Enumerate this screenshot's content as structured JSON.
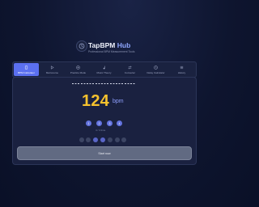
{
  "app": {
    "title_part1": "TapBPM",
    "title_part2": " Hub",
    "tagline": "Professional BPM Measurement Tools",
    "accent_color": "#5b70f0",
    "bpm_color": "#f6c22e"
  },
  "tabs": [
    {
      "label": "BPM Calculator",
      "icon": "tap-icon",
      "active": true
    },
    {
      "label": "Metronome",
      "icon": "play-icon",
      "active": false
    },
    {
      "label": "Practice Mode",
      "icon": "target-icon",
      "active": false
    },
    {
      "label": "Music Theory",
      "icon": "music-note-icon",
      "active": false
    },
    {
      "label": "Converter",
      "icon": "convert-icon",
      "active": false
    },
    {
      "label": "Delay Calculator",
      "icon": "clock-icon",
      "active": false
    },
    {
      "label": "History",
      "icon": "history-icon",
      "active": false
    }
  ],
  "calculator": {
    "bpm_value": "124",
    "bpm_unit": "bpm",
    "beats": [
      "1",
      "2",
      "3",
      "4"
    ],
    "beat_label": "4 / 4 time",
    "start_label": "Start now"
  }
}
